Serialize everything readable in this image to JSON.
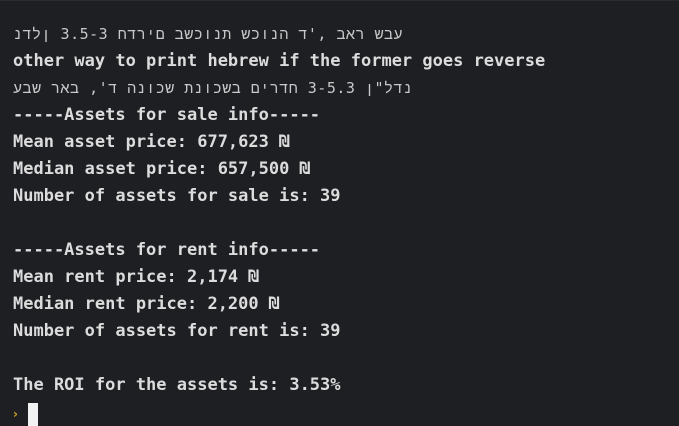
{
  "terminal": {
    "lines": [
      "עבש ראב ,'ד הנוכש תנוכשב םירדח 3.5-3 ןלדנ",
      "other way to print hebrew if the former goes reverse",
      "נדל\"ן 3-5.3 חדרים בשכונת שכונה ד', באר שבע",
      "-----Assets for sale info-----",
      "Mean asset price: 677,623 ₪",
      "Median asset price: 657,500 ₪",
      "Number of assets for sale is: 39",
      "",
      "-----Assets for rent info-----",
      "Mean rent price: 2,174 ₪",
      "Median rent price: 2,200 ₪",
      "Number of assets for rent is: 39",
      "",
      "The ROI for the assets is: 3.53%"
    ],
    "prompt_symbol": "›"
  }
}
